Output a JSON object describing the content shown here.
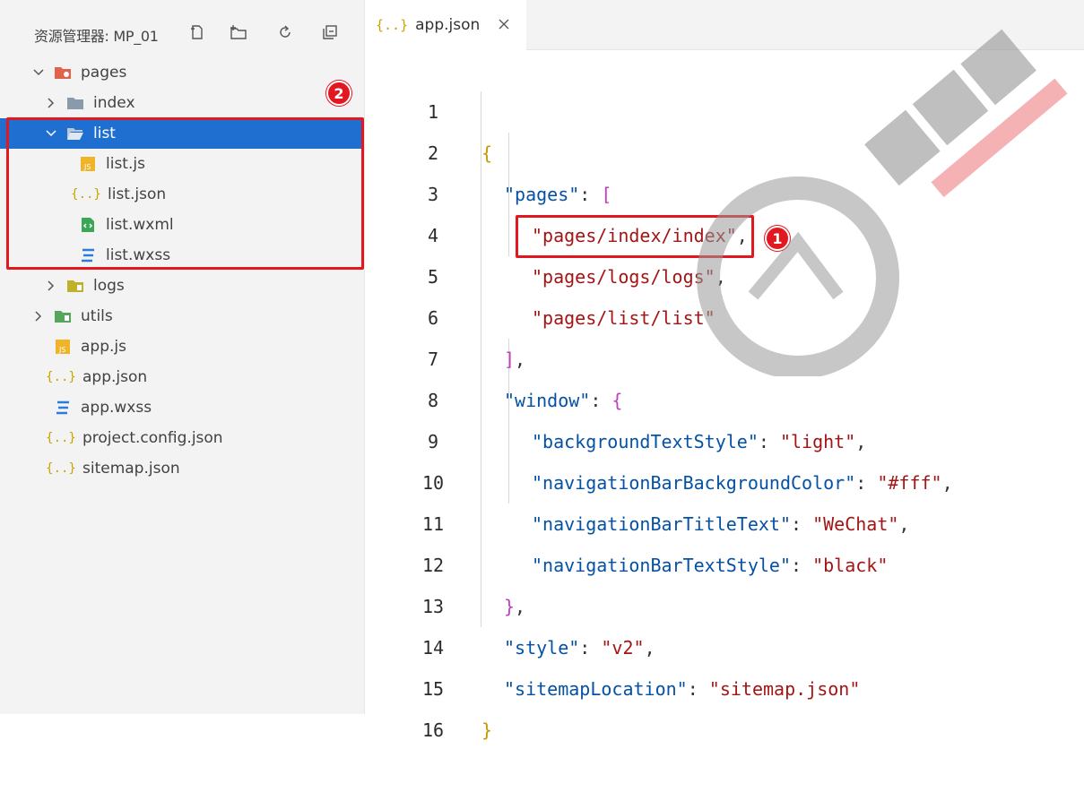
{
  "explorer": {
    "title": "资源管理器: MP_01",
    "actions": [
      "new-file-icon",
      "new-folder-icon",
      "refresh-icon",
      "collapse-all-icon"
    ],
    "tree": [
      {
        "label": "pages",
        "icon": "folder-pages-icon",
        "expanded": true,
        "depth": 0
      },
      {
        "label": "index",
        "icon": "folder-icon",
        "expanded": false,
        "depth": 1
      },
      {
        "label": "list",
        "icon": "folder-open-icon",
        "expanded": true,
        "depth": 1,
        "selected": true
      },
      {
        "label": "list.js",
        "icon": "js-file-icon",
        "depth": 2
      },
      {
        "label": "list.json",
        "icon": "json-file-icon",
        "depth": 2
      },
      {
        "label": "list.wxml",
        "icon": "wxml-file-icon",
        "depth": 2
      },
      {
        "label": "list.wxss",
        "icon": "css-file-icon",
        "depth": 2
      },
      {
        "label": "logs",
        "icon": "folder-logs-icon",
        "expanded": false,
        "depth": 1
      },
      {
        "label": "utils",
        "icon": "folder-utils-icon",
        "expanded": false,
        "depth": 0
      },
      {
        "label": "app.js",
        "icon": "js-file-icon",
        "depth": 0
      },
      {
        "label": "app.json",
        "icon": "json-file-icon",
        "depth": 0
      },
      {
        "label": "app.wxss",
        "icon": "css-file-icon",
        "depth": 0
      },
      {
        "label": "project.config.json",
        "icon": "json-file-icon",
        "depth": 0
      },
      {
        "label": "sitemap.json",
        "icon": "json-file-icon",
        "depth": 0
      }
    ]
  },
  "tab": {
    "icon": "{..}",
    "label": "app.json",
    "close": "close-icon"
  },
  "editor": {
    "lines": [
      {
        "n": "1"
      },
      {
        "n": "2"
      },
      {
        "n": "3"
      },
      {
        "n": "4"
      },
      {
        "n": "5"
      },
      {
        "n": "6"
      },
      {
        "n": "7"
      },
      {
        "n": "8"
      },
      {
        "n": "9"
      },
      {
        "n": "10"
      },
      {
        "n": "11"
      },
      {
        "n": "12"
      },
      {
        "n": "13"
      },
      {
        "n": "14"
      },
      {
        "n": "15"
      },
      {
        "n": "16"
      }
    ],
    "tokens": {
      "l1": "{",
      "l2k": "\"pages\"",
      "l2p": ": ",
      "l2b": "[",
      "l3": "\"pages/index/index\"",
      "l3p": ",",
      "l4": "\"pages/logs/logs\"",
      "l4p": ",",
      "l5": "\"pages/list/list\"",
      "l6b": "]",
      "l6p": ",",
      "l7k": "\"window\"",
      "l7p": ": ",
      "l7b": "{",
      "l8k": "\"backgroundTextStyle\"",
      "l8p": ": ",
      "l8v": "\"light\"",
      "l8c": ",",
      "l9k": "\"navigationBarBackgroundColor\"",
      "l9p": ": ",
      "l9v": "\"#fff\"",
      "l9c": ",",
      "l10k": "\"navigationBarTitleText\"",
      "l10p": ": ",
      "l10v": "\"WeChat\"",
      "l10c": ",",
      "l11k": "\"navigationBarTextStyle\"",
      "l11p": ": ",
      "l11v": "\"black\"",
      "l12b": "}",
      "l12p": ",",
      "l13k": "\"style\"",
      "l13p": ": ",
      "l13v": "\"v2\"",
      "l13c": ",",
      "l14k": "\"sitemapLocation\"",
      "l14p": ": ",
      "l14v": "\"sitemap.json\"",
      "l15": "}"
    }
  },
  "annotations": {
    "badge1": "1",
    "badge2": "2"
  },
  "colors": {
    "highlight": "#e3171f",
    "selection": "#1f6fd1",
    "key": "#0451a5",
    "string": "#a31515"
  }
}
